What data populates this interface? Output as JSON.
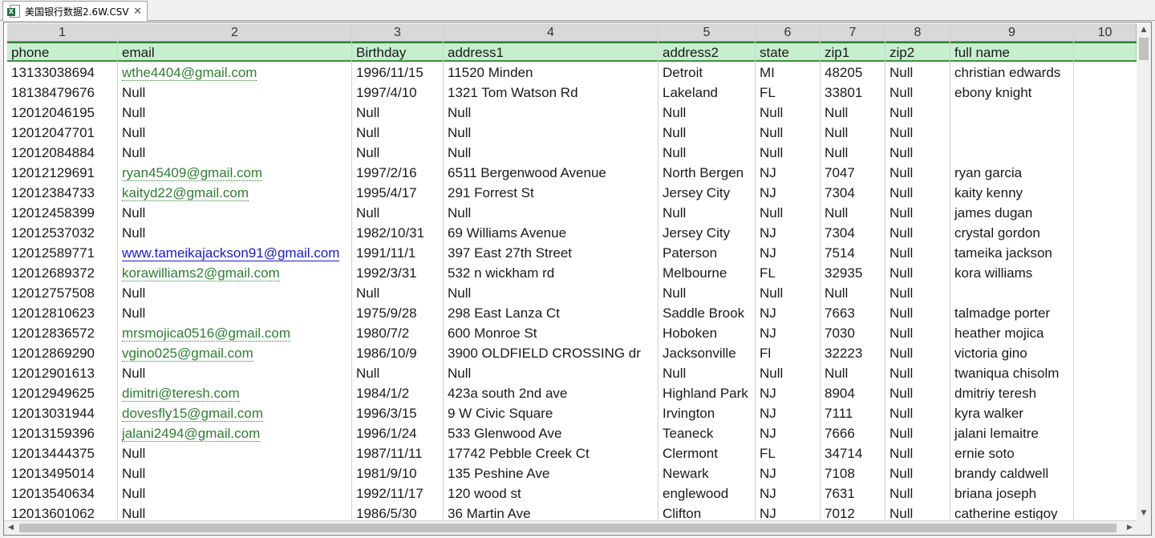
{
  "tab": {
    "title": "美国银行数据2.6W.CSV",
    "file_icon": "excel-file-icon",
    "close_icon": "close-icon"
  },
  "columns": [
    "1",
    "2",
    "3",
    "4",
    "5",
    "6",
    "7",
    "8",
    "9",
    "10"
  ],
  "headers": [
    "phone",
    "email",
    "Birthday",
    "address1",
    "address2",
    "state",
    "zip1",
    "zip2",
    "full name",
    ""
  ],
  "rows": [
    [
      "13133038694",
      "wthe4404@gmail.com",
      "1996/11/15",
      "11520 Minden",
      "Detroit",
      "MI",
      "48205",
      "Null",
      "christian edwards"
    ],
    [
      "18138479676",
      "Null",
      "1997/4/10",
      "1321 Tom Watson Rd",
      "Lakeland",
      "FL",
      "33801",
      "Null",
      "ebony knight"
    ],
    [
      "12012046195",
      "Null",
      "Null",
      "Null",
      "Null",
      "Null",
      "Null",
      "Null",
      ""
    ],
    [
      "12012047701",
      "Null",
      "Null",
      "Null",
      "Null",
      "Null",
      "Null",
      "Null",
      ""
    ],
    [
      "12012084884",
      "Null",
      "Null",
      "Null",
      "Null",
      "Null",
      "Null",
      "Null",
      ""
    ],
    [
      "12012129691",
      "ryan45409@gmail.com",
      "1997/2/16",
      "6511 Bergenwood Avenue",
      "North Bergen",
      "NJ",
      "7047",
      "Null",
      "ryan garcia"
    ],
    [
      "12012384733",
      "kaityd22@gmail.com",
      "1995/4/17",
      "291 Forrest St",
      "Jersey City",
      "NJ",
      "7304",
      "Null",
      "kaity kenny"
    ],
    [
      "12012458399",
      "Null",
      "Null",
      "Null",
      "Null",
      "Null",
      "Null",
      "Null",
      "james dugan"
    ],
    [
      "12012537032",
      "Null",
      "1982/10/31",
      "69 Williams Avenue",
      "Jersey City",
      "NJ",
      "7304",
      "Null",
      "crystal gordon"
    ],
    [
      "12012589771",
      "www.tameikajackson91@gmail.com",
      "1991/11/1",
      "397 East 27th Street",
      "Paterson",
      "NJ",
      "7514",
      "Null",
      "tameika jackson"
    ],
    [
      "12012689372",
      "korawilliams2@gmail.com",
      "1992/3/31",
      "532 n wickham rd",
      "Melbourne",
      "FL",
      "32935",
      "Null",
      "kora williams"
    ],
    [
      "12012757508",
      "Null",
      "Null",
      "Null",
      "Null",
      "Null",
      "Null",
      "Null",
      ""
    ],
    [
      "12012810623",
      "Null",
      "1975/9/28",
      "298 East Lanza Ct",
      "Saddle Brook",
      "NJ",
      "7663",
      "Null",
      "talmadge porter"
    ],
    [
      "12012836572",
      "mrsmojica0516@gmail.com",
      "1980/7/2",
      "600 Monroe St",
      "Hoboken",
      "NJ",
      "7030",
      "Null",
      "heather mojica"
    ],
    [
      "12012869290",
      "vgino025@gmail.com",
      "1986/10/9",
      "3900 OLDFIELD CROSSING dr",
      "Jacksonville",
      "Fl",
      "32223",
      "Null",
      "victoria gino"
    ],
    [
      "12012901613",
      "Null",
      "Null",
      "Null",
      "Null",
      "Null",
      "Null",
      "Null",
      "twaniqua chisolm"
    ],
    [
      "12012949625",
      "dimitri@teresh.com",
      "1984/1/2",
      "423a south 2nd ave",
      "Highland Park",
      "NJ",
      "8904",
      "Null",
      "dmitriy teresh"
    ],
    [
      "12013031944",
      "dovesfly15@gmail.com",
      "1996/3/15",
      "9 W Civic Square",
      "Irvington",
      "NJ",
      "7111",
      "Null",
      "kyra walker"
    ],
    [
      "12013159396",
      "jalani2494@gmail.com",
      "1996/1/24",
      "533 Glenwood Ave",
      "Teaneck",
      "NJ",
      "7666",
      "Null",
      "jalani lemaitre"
    ],
    [
      "12013444375",
      "Null",
      "1987/11/11",
      "17742 Pebble Creek Ct",
      "Clermont",
      "FL",
      "34714",
      "Null",
      "ernie soto"
    ],
    [
      "12013495014",
      "Null",
      "1981/9/10",
      "135 Peshine Ave",
      "Newark",
      "NJ",
      "7108",
      "Null",
      "brandy caldwell"
    ],
    [
      "12013540634",
      "Null",
      "1992/11/17",
      "120 wood st",
      "englewood",
      "NJ",
      "7631",
      "Null",
      "briana joseph"
    ],
    [
      "12013601062",
      "Null",
      "1986/5/30",
      "36 Martin Ave",
      "Clifton",
      "NJ",
      "7012",
      "Null",
      "catherine estigoy"
    ]
  ],
  "scrollbars": {
    "up_icon": "arrow-up-icon",
    "down_icon": "arrow-down-icon",
    "left_icon": "arrow-left-icon",
    "right_icon": "arrow-right-icon"
  }
}
